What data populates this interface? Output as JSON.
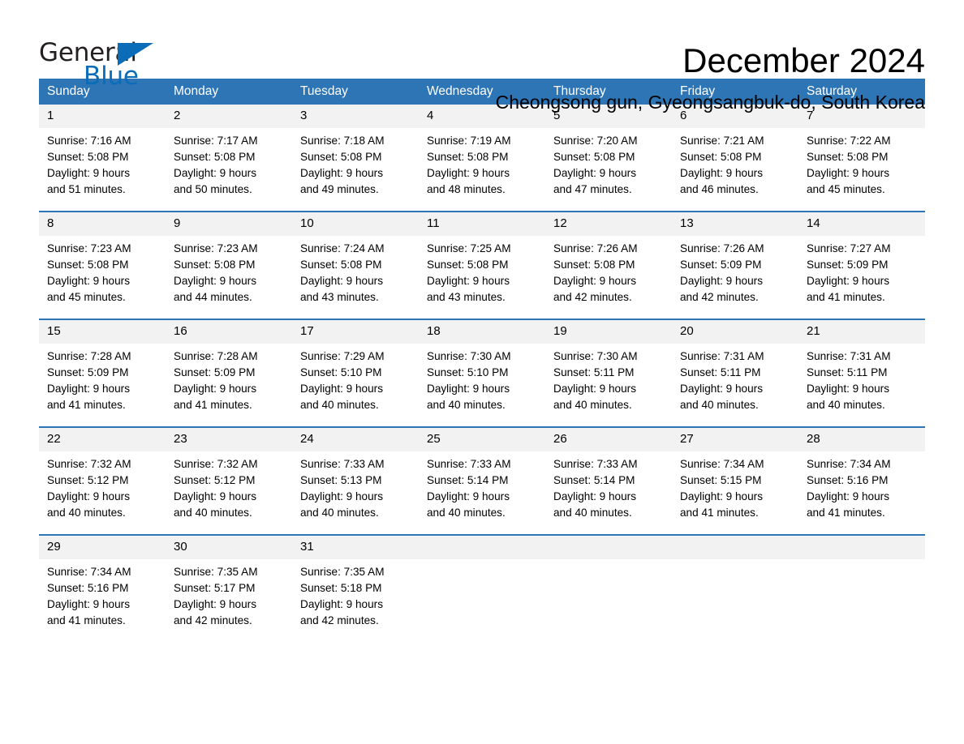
{
  "logo": {
    "word_general": "General",
    "word_blue": "Blue",
    "triangle_color": "#0b6cb7"
  },
  "header": {
    "title": "December 2024",
    "subtitle": "Cheongsong gun, Gyeongsangbuk-do, South Korea"
  },
  "theme": {
    "header_bg": "#2e75b6",
    "header_text": "#ffffff",
    "daynum_bg": "#f2f2f2",
    "row_divider": "#2e75b6",
    "page_bg": "#ffffff",
    "text": "#000000"
  },
  "calendar": {
    "weekday_headers": [
      "Sunday",
      "Monday",
      "Tuesday",
      "Wednesday",
      "Thursday",
      "Friday",
      "Saturday"
    ],
    "weeks": [
      [
        {
          "day": "1",
          "sunrise": "Sunrise: 7:16 AM",
          "sunset": "Sunset: 5:08 PM",
          "daylight_line1": "Daylight: 9 hours",
          "daylight_line2": "and 51 minutes."
        },
        {
          "day": "2",
          "sunrise": "Sunrise: 7:17 AM",
          "sunset": "Sunset: 5:08 PM",
          "daylight_line1": "Daylight: 9 hours",
          "daylight_line2": "and 50 minutes."
        },
        {
          "day": "3",
          "sunrise": "Sunrise: 7:18 AM",
          "sunset": "Sunset: 5:08 PM",
          "daylight_line1": "Daylight: 9 hours",
          "daylight_line2": "and 49 minutes."
        },
        {
          "day": "4",
          "sunrise": "Sunrise: 7:19 AM",
          "sunset": "Sunset: 5:08 PM",
          "daylight_line1": "Daylight: 9 hours",
          "daylight_line2": "and 48 minutes."
        },
        {
          "day": "5",
          "sunrise": "Sunrise: 7:20 AM",
          "sunset": "Sunset: 5:08 PM",
          "daylight_line1": "Daylight: 9 hours",
          "daylight_line2": "and 47 minutes."
        },
        {
          "day": "6",
          "sunrise": "Sunrise: 7:21 AM",
          "sunset": "Sunset: 5:08 PM",
          "daylight_line1": "Daylight: 9 hours",
          "daylight_line2": "and 46 minutes."
        },
        {
          "day": "7",
          "sunrise": "Sunrise: 7:22 AM",
          "sunset": "Sunset: 5:08 PM",
          "daylight_line1": "Daylight: 9 hours",
          "daylight_line2": "and 45 minutes."
        }
      ],
      [
        {
          "day": "8",
          "sunrise": "Sunrise: 7:23 AM",
          "sunset": "Sunset: 5:08 PM",
          "daylight_line1": "Daylight: 9 hours",
          "daylight_line2": "and 45 minutes."
        },
        {
          "day": "9",
          "sunrise": "Sunrise: 7:23 AM",
          "sunset": "Sunset: 5:08 PM",
          "daylight_line1": "Daylight: 9 hours",
          "daylight_line2": "and 44 minutes."
        },
        {
          "day": "10",
          "sunrise": "Sunrise: 7:24 AM",
          "sunset": "Sunset: 5:08 PM",
          "daylight_line1": "Daylight: 9 hours",
          "daylight_line2": "and 43 minutes."
        },
        {
          "day": "11",
          "sunrise": "Sunrise: 7:25 AM",
          "sunset": "Sunset: 5:08 PM",
          "daylight_line1": "Daylight: 9 hours",
          "daylight_line2": "and 43 minutes."
        },
        {
          "day": "12",
          "sunrise": "Sunrise: 7:26 AM",
          "sunset": "Sunset: 5:08 PM",
          "daylight_line1": "Daylight: 9 hours",
          "daylight_line2": "and 42 minutes."
        },
        {
          "day": "13",
          "sunrise": "Sunrise: 7:26 AM",
          "sunset": "Sunset: 5:09 PM",
          "daylight_line1": "Daylight: 9 hours",
          "daylight_line2": "and 42 minutes."
        },
        {
          "day": "14",
          "sunrise": "Sunrise: 7:27 AM",
          "sunset": "Sunset: 5:09 PM",
          "daylight_line1": "Daylight: 9 hours",
          "daylight_line2": "and 41 minutes."
        }
      ],
      [
        {
          "day": "15",
          "sunrise": "Sunrise: 7:28 AM",
          "sunset": "Sunset: 5:09 PM",
          "daylight_line1": "Daylight: 9 hours",
          "daylight_line2": "and 41 minutes."
        },
        {
          "day": "16",
          "sunrise": "Sunrise: 7:28 AM",
          "sunset": "Sunset: 5:09 PM",
          "daylight_line1": "Daylight: 9 hours",
          "daylight_line2": "and 41 minutes."
        },
        {
          "day": "17",
          "sunrise": "Sunrise: 7:29 AM",
          "sunset": "Sunset: 5:10 PM",
          "daylight_line1": "Daylight: 9 hours",
          "daylight_line2": "and 40 minutes."
        },
        {
          "day": "18",
          "sunrise": "Sunrise: 7:30 AM",
          "sunset": "Sunset: 5:10 PM",
          "daylight_line1": "Daylight: 9 hours",
          "daylight_line2": "and 40 minutes."
        },
        {
          "day": "19",
          "sunrise": "Sunrise: 7:30 AM",
          "sunset": "Sunset: 5:11 PM",
          "daylight_line1": "Daylight: 9 hours",
          "daylight_line2": "and 40 minutes."
        },
        {
          "day": "20",
          "sunrise": "Sunrise: 7:31 AM",
          "sunset": "Sunset: 5:11 PM",
          "daylight_line1": "Daylight: 9 hours",
          "daylight_line2": "and 40 minutes."
        },
        {
          "day": "21",
          "sunrise": "Sunrise: 7:31 AM",
          "sunset": "Sunset: 5:11 PM",
          "daylight_line1": "Daylight: 9 hours",
          "daylight_line2": "and 40 minutes."
        }
      ],
      [
        {
          "day": "22",
          "sunrise": "Sunrise: 7:32 AM",
          "sunset": "Sunset: 5:12 PM",
          "daylight_line1": "Daylight: 9 hours",
          "daylight_line2": "and 40 minutes."
        },
        {
          "day": "23",
          "sunrise": "Sunrise: 7:32 AM",
          "sunset": "Sunset: 5:12 PM",
          "daylight_line1": "Daylight: 9 hours",
          "daylight_line2": "and 40 minutes."
        },
        {
          "day": "24",
          "sunrise": "Sunrise: 7:33 AM",
          "sunset": "Sunset: 5:13 PM",
          "daylight_line1": "Daylight: 9 hours",
          "daylight_line2": "and 40 minutes."
        },
        {
          "day": "25",
          "sunrise": "Sunrise: 7:33 AM",
          "sunset": "Sunset: 5:14 PM",
          "daylight_line1": "Daylight: 9 hours",
          "daylight_line2": "and 40 minutes."
        },
        {
          "day": "26",
          "sunrise": "Sunrise: 7:33 AM",
          "sunset": "Sunset: 5:14 PM",
          "daylight_line1": "Daylight: 9 hours",
          "daylight_line2": "and 40 minutes."
        },
        {
          "day": "27",
          "sunrise": "Sunrise: 7:34 AM",
          "sunset": "Sunset: 5:15 PM",
          "daylight_line1": "Daylight: 9 hours",
          "daylight_line2": "and 41 minutes."
        },
        {
          "day": "28",
          "sunrise": "Sunrise: 7:34 AM",
          "sunset": "Sunset: 5:16 PM",
          "daylight_line1": "Daylight: 9 hours",
          "daylight_line2": "and 41 minutes."
        }
      ],
      [
        {
          "day": "29",
          "sunrise": "Sunrise: 7:34 AM",
          "sunset": "Sunset: 5:16 PM",
          "daylight_line1": "Daylight: 9 hours",
          "daylight_line2": "and 41 minutes."
        },
        {
          "day": "30",
          "sunrise": "Sunrise: 7:35 AM",
          "sunset": "Sunset: 5:17 PM",
          "daylight_line1": "Daylight: 9 hours",
          "daylight_line2": "and 42 minutes."
        },
        {
          "day": "31",
          "sunrise": "Sunrise: 7:35 AM",
          "sunset": "Sunset: 5:18 PM",
          "daylight_line1": "Daylight: 9 hours",
          "daylight_line2": "and 42 minutes."
        },
        {
          "day": "",
          "sunrise": "",
          "sunset": "",
          "daylight_line1": "",
          "daylight_line2": "",
          "empty": true
        },
        {
          "day": "",
          "sunrise": "",
          "sunset": "",
          "daylight_line1": "",
          "daylight_line2": "",
          "empty": true
        },
        {
          "day": "",
          "sunrise": "",
          "sunset": "",
          "daylight_line1": "",
          "daylight_line2": "",
          "empty": true
        },
        {
          "day": "",
          "sunrise": "",
          "sunset": "",
          "daylight_line1": "",
          "daylight_line2": "",
          "empty": true
        }
      ]
    ]
  }
}
